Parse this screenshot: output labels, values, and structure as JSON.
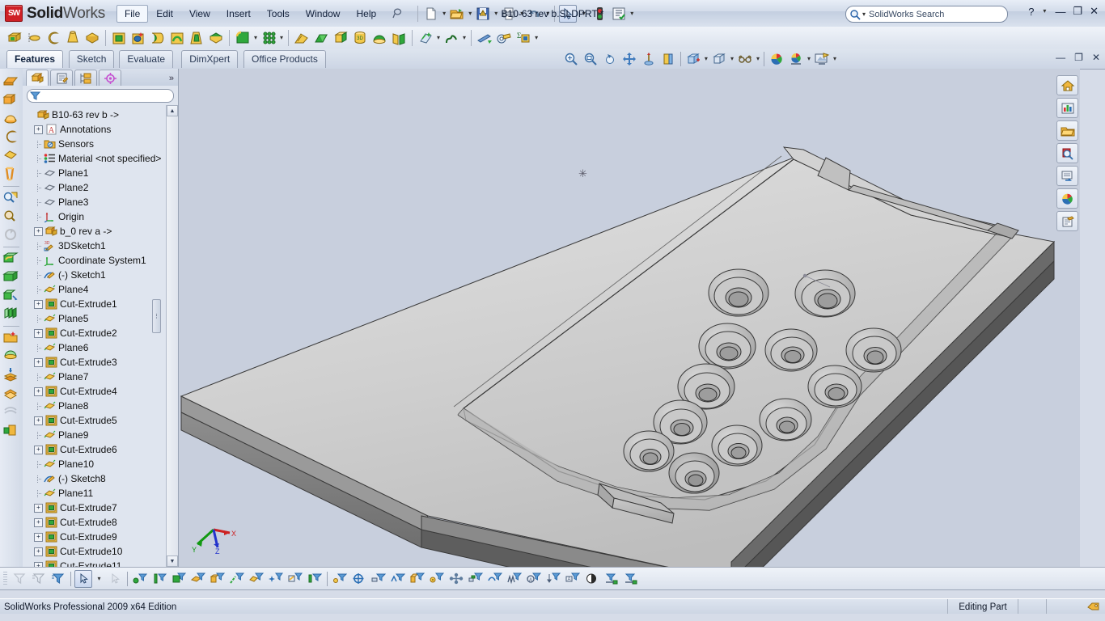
{
  "app": {
    "brand_bold": "Solid",
    "brand_light": "Works",
    "logo_text": "SW",
    "document_title": "B10-63 rev b.SLDPRT *",
    "edition": "SolidWorks Professional 2009 x64 Edition",
    "accent": "#cf2026",
    "chrome_bg": "#d6dce8",
    "viewport_bg": "#c8cfdd"
  },
  "menubar": {
    "items": [
      {
        "label": "File",
        "active": true
      },
      {
        "label": "Edit",
        "active": false
      },
      {
        "label": "View",
        "active": false
      },
      {
        "label": "Insert",
        "active": false
      },
      {
        "label": "Tools",
        "active": false
      },
      {
        "label": "Window",
        "active": false
      },
      {
        "label": "Help",
        "active": false
      }
    ],
    "pin_icon": "pushpin-icon"
  },
  "search": {
    "placeholder": "SolidWorks Search",
    "icon": "search-icon",
    "dropdown_icon": "chevron-down-icon"
  },
  "window_controls": {
    "help": "?",
    "help_dropdown": "▾",
    "minimize": "—",
    "restore": "❐",
    "close": "✕"
  },
  "cmd_window_controls": {
    "minimize": "—",
    "restore": "❐",
    "close": "✕"
  },
  "standard_toolbar": {
    "items": [
      {
        "name": "new-document-button",
        "glyph": "page"
      },
      {
        "name": "new-document-dropdown",
        "glyph": "caret"
      },
      {
        "name": "open-document-button",
        "glyph": "folder-open"
      },
      {
        "name": "open-document-dropdown",
        "glyph": "caret"
      },
      {
        "name": "save-button",
        "glyph": "save-warn"
      },
      {
        "name": "save-dropdown",
        "glyph": "caret"
      },
      {
        "name": "print-button",
        "glyph": "printer"
      },
      {
        "name": "print-dropdown",
        "glyph": "caret"
      },
      {
        "name": "undo-button",
        "glyph": "undo"
      },
      {
        "name": "undo-dropdown",
        "glyph": "caret"
      },
      {
        "name": "select-button",
        "glyph": "cursor"
      },
      {
        "name": "select-dropdown",
        "glyph": "caret"
      },
      {
        "name": "rebuild-button",
        "glyph": "traffic-light"
      },
      {
        "name": "options-button",
        "glyph": "options-list"
      },
      {
        "name": "options-dropdown",
        "glyph": "caret"
      }
    ]
  },
  "features_toolbar": {
    "items": [
      {
        "name": "extruded-boss-base-icon"
      },
      {
        "name": "revolved-boss-base-icon"
      },
      {
        "name": "swept-boss-base-icon"
      },
      {
        "name": "lofted-boss-base-icon"
      },
      {
        "name": "boundary-boss-base-icon"
      },
      {
        "name": "extruded-cut-icon"
      },
      {
        "name": "hole-wizard-icon"
      },
      {
        "name": "revolved-cut-icon"
      },
      {
        "name": "swept-cut-icon"
      },
      {
        "name": "lofted-cut-icon"
      },
      {
        "name": "boundary-cut-icon"
      },
      {
        "name": "fillet-icon"
      },
      {
        "name": "fillet-dropdown-icon"
      },
      {
        "name": "linear-pattern-icon"
      },
      {
        "name": "linear-pattern-dropdown-icon"
      },
      {
        "name": "rib-icon"
      },
      {
        "name": "draft-icon"
      },
      {
        "name": "shell-icon"
      },
      {
        "name": "wrap-icon"
      },
      {
        "name": "dome-icon"
      },
      {
        "name": "mirror-icon"
      },
      {
        "name": "reference-geometry-icon"
      },
      {
        "name": "reference-geometry-dropdown-icon"
      },
      {
        "name": "curves-icon"
      },
      {
        "name": "curves-dropdown-icon"
      },
      {
        "name": "instant3d-icon"
      },
      {
        "name": "measure-icon"
      },
      {
        "name": "mass-properties-icon"
      },
      {
        "name": "evaluate-dropdown-icon"
      }
    ]
  },
  "command_manager": {
    "tabs": [
      {
        "label": "Features",
        "selected": true
      },
      {
        "label": "Sketch",
        "selected": false
      },
      {
        "label": "Evaluate",
        "selected": false
      },
      {
        "label": "DimXpert",
        "selected": false
      },
      {
        "label": "Office Products",
        "selected": false
      }
    ]
  },
  "view_toolbar": {
    "items": [
      {
        "name": "zoom-to-fit-icon"
      },
      {
        "name": "zoom-to-area-icon"
      },
      {
        "name": "previous-view-icon"
      },
      {
        "name": "pan-icon"
      },
      {
        "name": "rotate-view-icon"
      },
      {
        "name": "section-view-icon"
      },
      {
        "name": "view-orientation-icon"
      },
      {
        "name": "view-orientation-dropdown-icon"
      },
      {
        "name": "display-style-icon"
      },
      {
        "name": "display-style-dropdown-icon"
      },
      {
        "name": "hide-show-items-icon"
      },
      {
        "name": "hide-show-items-dropdown-icon"
      },
      {
        "name": "edit-appearance-icon"
      },
      {
        "name": "apply-scene-icon"
      },
      {
        "name": "apply-scene-dropdown-icon"
      },
      {
        "name": "view-settings-icon"
      },
      {
        "name": "view-settings-dropdown-icon"
      }
    ]
  },
  "left_toolbar": {
    "items": [
      {
        "name": "extruded-boss-base-icon"
      },
      {
        "name": "extruded-surface-icon"
      },
      {
        "name": "revolved-surface-icon"
      },
      {
        "name": "swept-surface-icon"
      },
      {
        "name": "planar-surface-icon"
      },
      {
        "name": "ruled-surface-icon"
      },
      {
        "name": "zoom-to-fit-icon"
      },
      {
        "name": "zoom-to-area-icon"
      },
      {
        "name": "rotate-view-icon"
      },
      {
        "name": "knit-surface-icon"
      },
      {
        "name": "extend-surface-icon"
      },
      {
        "name": "trim-surface-icon"
      },
      {
        "name": "thicken-icon"
      },
      {
        "name": "offset-surface-icon"
      },
      {
        "name": "filled-surface-icon"
      },
      {
        "name": "midsurface-icon"
      },
      {
        "name": "replace-face-icon"
      },
      {
        "name": "freeform-icon"
      },
      {
        "name": "delete-face-icon"
      }
    ]
  },
  "feature_manager": {
    "tabs": [
      {
        "name": "featuremanager-design-tree-tab",
        "icon": "tree-icon",
        "selected": true
      },
      {
        "name": "property-manager-tab",
        "icon": "property-icon",
        "selected": false
      },
      {
        "name": "configuration-manager-tab",
        "icon": "config-icon",
        "selected": false
      },
      {
        "name": "dimxpert-manager-tab",
        "icon": "dimxpert-icon",
        "selected": false
      }
    ],
    "more_tabs": "»",
    "filter": {
      "icon": "filter-icon",
      "placeholder": "",
      "value": ""
    },
    "scrollbar": {
      "up": "▲",
      "down": "▼"
    },
    "splitter_grip": "⋮",
    "tree": [
      {
        "label": "B10-63 rev b ->",
        "icon": "part-icon",
        "expandable": false,
        "root": true,
        "indent": 0
      },
      {
        "label": "Annotations",
        "icon": "annotations-icon",
        "expandable": true,
        "root": false,
        "indent": 1
      },
      {
        "label": "Sensors",
        "icon": "sensors-icon",
        "expandable": false,
        "root": false,
        "indent": 1
      },
      {
        "label": "Material <not specified>",
        "icon": "material-icon",
        "expandable": false,
        "root": false,
        "indent": 1
      },
      {
        "label": "Plane1",
        "icon": "plane-icon",
        "expandable": false,
        "root": false,
        "indent": 1
      },
      {
        "label": "Plane2",
        "icon": "plane-icon",
        "expandable": false,
        "root": false,
        "indent": 1
      },
      {
        "label": "Plane3",
        "icon": "plane-icon",
        "expandable": false,
        "root": false,
        "indent": 1
      },
      {
        "label": "Origin",
        "icon": "origin-icon",
        "expandable": false,
        "root": false,
        "indent": 1
      },
      {
        "label": "b_0 rev a ->",
        "icon": "part-icon",
        "expandable": true,
        "root": false,
        "indent": 1
      },
      {
        "label": "3DSketch1",
        "icon": "sketch3d-icon",
        "expandable": false,
        "root": false,
        "indent": 1
      },
      {
        "label": "Coordinate System1",
        "icon": "coordsys-icon",
        "expandable": false,
        "root": false,
        "indent": 1
      },
      {
        "label": "(-) Sketch1",
        "icon": "sketch-icon",
        "expandable": false,
        "root": false,
        "indent": 1
      },
      {
        "label": "Plane4",
        "icon": "plane-gold-icon",
        "expandable": false,
        "root": false,
        "indent": 1
      },
      {
        "label": "Cut-Extrude1",
        "icon": "cut-extrude-icon",
        "expandable": true,
        "root": false,
        "indent": 1
      },
      {
        "label": "Plane5",
        "icon": "plane-gold-icon",
        "expandable": false,
        "root": false,
        "indent": 1
      },
      {
        "label": "Cut-Extrude2",
        "icon": "cut-extrude-icon",
        "expandable": true,
        "root": false,
        "indent": 1
      },
      {
        "label": "Plane6",
        "icon": "plane-gold-icon",
        "expandable": false,
        "root": false,
        "indent": 1
      },
      {
        "label": "Cut-Extrude3",
        "icon": "cut-extrude-icon",
        "expandable": true,
        "root": false,
        "indent": 1
      },
      {
        "label": "Plane7",
        "icon": "plane-gold-icon",
        "expandable": false,
        "root": false,
        "indent": 1
      },
      {
        "label": "Cut-Extrude4",
        "icon": "cut-extrude-icon",
        "expandable": true,
        "root": false,
        "indent": 1
      },
      {
        "label": "Plane8",
        "icon": "plane-gold-icon",
        "expandable": false,
        "root": false,
        "indent": 1
      },
      {
        "label": "Cut-Extrude5",
        "icon": "cut-extrude-icon",
        "expandable": true,
        "root": false,
        "indent": 1
      },
      {
        "label": "Plane9",
        "icon": "plane-gold-icon",
        "expandable": false,
        "root": false,
        "indent": 1
      },
      {
        "label": "Cut-Extrude6",
        "icon": "cut-extrude-icon",
        "expandable": true,
        "root": false,
        "indent": 1
      },
      {
        "label": "Plane10",
        "icon": "plane-gold-icon",
        "expandable": false,
        "root": false,
        "indent": 1
      },
      {
        "label": "(-) Sketch8",
        "icon": "sketch-icon",
        "expandable": false,
        "root": false,
        "indent": 1
      },
      {
        "label": "Plane11",
        "icon": "plane-gold-icon",
        "expandable": false,
        "root": false,
        "indent": 1
      },
      {
        "label": "Cut-Extrude7",
        "icon": "cut-extrude-icon",
        "expandable": true,
        "root": false,
        "indent": 1
      },
      {
        "label": "Cut-Extrude8",
        "icon": "cut-extrude-icon",
        "expandable": true,
        "root": false,
        "indent": 1
      },
      {
        "label": "Cut-Extrude9",
        "icon": "cut-extrude-icon",
        "expandable": true,
        "root": false,
        "indent": 1
      },
      {
        "label": "Cut-Extrude10",
        "icon": "cut-extrude-icon",
        "expandable": true,
        "root": false,
        "indent": 1
      },
      {
        "label": "Cut-Extrude11",
        "icon": "cut-extrude-icon",
        "expandable": true,
        "root": false,
        "indent": 1
      }
    ]
  },
  "viewport": {
    "model_name": "B10-63 rev b",
    "origin_marker": "✳",
    "triad": {
      "x_label": "X",
      "y_label": "Y",
      "z_label": "Z",
      "x_color": "#cc2222",
      "y_color": "#119911",
      "z_color": "#2233cc"
    },
    "right_toolbar": [
      {
        "name": "view-home-icon"
      },
      {
        "name": "view-orientation-icon"
      },
      {
        "name": "open-recent-icon"
      },
      {
        "name": "search-model-icon"
      },
      {
        "name": "display-pane-icon"
      },
      {
        "name": "appearances-icon"
      },
      {
        "name": "custom-properties-icon"
      }
    ]
  },
  "bottom_toolbar": {
    "items": [
      {
        "name": "filter-none-icon"
      },
      {
        "name": "filter-clear-icon"
      },
      {
        "name": "filter-toggle-icon"
      },
      {
        "name": "select-tool-icon",
        "selected": true
      },
      {
        "name": "select-tool-dropdown-icon"
      },
      {
        "name": "select-other-icon"
      },
      {
        "name": "filter-vertices-icon"
      },
      {
        "name": "filter-edges-icon"
      },
      {
        "name": "filter-faces-icon"
      },
      {
        "name": "filter-surface-bodies-icon"
      },
      {
        "name": "filter-solid-bodies-icon"
      },
      {
        "name": "filter-axes-icon"
      },
      {
        "name": "filter-planes-icon"
      },
      {
        "name": "filter-sketch-points-icon"
      },
      {
        "name": "filter-sketch-segments-icon"
      },
      {
        "name": "filter-midpoints-icon"
      },
      {
        "name": "filter-center-marks-icon"
      },
      {
        "name": "filter-centerlines-icon"
      },
      {
        "name": "filter-dimensions-icon"
      },
      {
        "name": "filter-surface-finish-icon"
      },
      {
        "name": "filter-blocks-icon"
      },
      {
        "name": "filter-dowel-symbols-icon"
      },
      {
        "name": "filter-connection-points-icon"
      },
      {
        "name": "filter-routing-points-icon"
      },
      {
        "name": "filter-notes-icon"
      },
      {
        "name": "filter-weld-beads-icon"
      },
      {
        "name": "filter-weld-symbols-icon"
      },
      {
        "name": "filter-datums-icon"
      },
      {
        "name": "filter-datum-targets-icon"
      },
      {
        "name": "filter-gtol-icon"
      },
      {
        "name": "filter-balloons-icon"
      },
      {
        "name": "filter-graphics-body-icon"
      },
      {
        "name": "filter-components-icon"
      }
    ]
  },
  "status_bar": {
    "left_text": "SolidWorks Professional 2009 x64 Edition",
    "state_text": "Editing Part",
    "tag_icon": "tag-icon"
  }
}
